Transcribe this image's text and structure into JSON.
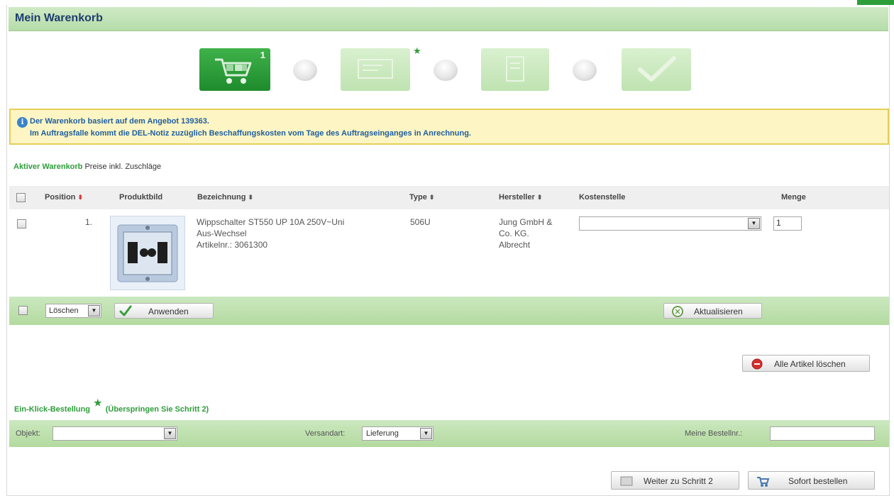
{
  "page": {
    "title": "Mein Warenkorb"
  },
  "steps": {
    "cart_count": "1"
  },
  "info": {
    "line1": "Der Warenkorb basiert auf dem Angebot 139363.",
    "line2": "Im Auftragsfalle kommt die DEL-Notiz zuzüglich Beschaffungskosten vom Tage des Auftragseinganges in Anrechnung."
  },
  "cart": {
    "active_label": "Aktiver Warenkorb",
    "price_note": "Preise inkl. Zuschläge"
  },
  "table": {
    "headers": {
      "position": "Position",
      "image": "Produktbild",
      "name": "Bezeichnung",
      "type": "Type",
      "manufacturer": "Hersteller",
      "cost_center": "Kostenstelle",
      "quantity": "Menge"
    },
    "rows": [
      {
        "position": "1.",
        "name_line1": "Wippschalter ST550 UP 10A 250V~Uni",
        "name_line2": "Aus-Wechsel",
        "article": "Artikelnr.: 3061300",
        "type": "506U",
        "manufacturer_line1": "Jung GmbH &",
        "manufacturer_line2": "Co. KG.",
        "manufacturer_line3": "Albrecht",
        "cost_center": "",
        "quantity": "1"
      }
    ]
  },
  "actions": {
    "bulk_action": "Löschen",
    "apply": "Anwenden",
    "refresh": "Aktualisieren",
    "delete_all": "Alle Artikel löschen"
  },
  "oneclick": {
    "title": "Ein-Klick-Bestellung",
    "note": "(Überspringen Sie Schritt 2)"
  },
  "order": {
    "object_label": "Objekt:",
    "object_value": "",
    "shipping_label": "Versandart:",
    "shipping_value": "Lieferung",
    "order_no_label": "Meine Bestellnr.:",
    "order_no_value": ""
  },
  "footer": {
    "next_step": "Weiter zu Schritt 2",
    "order_now": "Sofort bestellen"
  },
  "colors": {
    "accent_green": "#2e9e3a",
    "title_blue": "#1f3d6e",
    "info_bg": "#fdf5c3",
    "info_border": "#e6cf58",
    "sort_active": "#d23232"
  }
}
